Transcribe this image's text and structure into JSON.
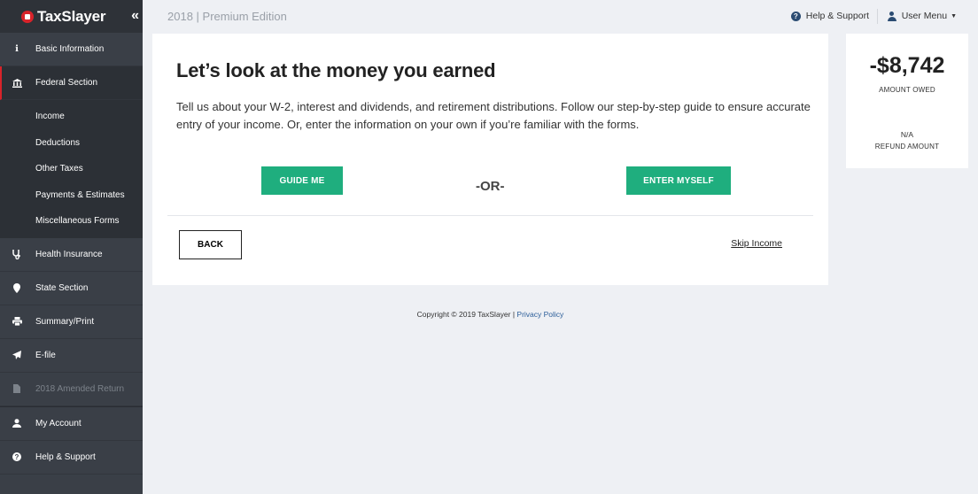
{
  "brand": {
    "name": "TaxSlayer",
    "collapse_icon": "double-chevron-left-icon"
  },
  "topbar": {
    "edition": "2018 | Premium Edition",
    "help_label": "Help & Support",
    "user_menu_label": "User Menu"
  },
  "sidebar": {
    "items": [
      {
        "label": "Basic Information",
        "icon": "info-icon"
      },
      {
        "label": "Federal Section",
        "icon": "bank-icon"
      },
      {
        "label": "Health Insurance",
        "icon": "stethoscope-icon"
      },
      {
        "label": "State Section",
        "icon": "map-pin-icon"
      },
      {
        "label": "Summary/Print",
        "icon": "printer-icon"
      },
      {
        "label": "E-file",
        "icon": "send-icon"
      },
      {
        "label": "2018 Amended Return",
        "icon": "document-icon"
      },
      {
        "label": "My Account",
        "icon": "user-icon"
      },
      {
        "label": "Help & Support",
        "icon": "question-icon"
      }
    ],
    "federal_sub": [
      "Income",
      "Deductions",
      "Other Taxes",
      "Payments & Estimates",
      "Miscellaneous Forms"
    ]
  },
  "main": {
    "heading": "Let’s look at the money you earned",
    "description": "Tell us about your W-2, interest and dividends, and retirement distributions. Follow our step-by-step guide to ensure accurate entry of your income. Or, enter the information on your own if you’re familiar with the forms.",
    "guide_button": "GUIDE ME",
    "or_text": "-OR-",
    "enter_button": "ENTER MYSELF",
    "back_button": "BACK",
    "skip_link": "Skip Income"
  },
  "summary": {
    "amount_owed_value": "-$8,742",
    "amount_owed_label": "AMOUNT OWED",
    "refund_value": "N/A",
    "refund_label": "REFUND AMOUNT"
  },
  "footer": {
    "copyright": "Copyright © 2019 TaxSlayer | ",
    "privacy": "Privacy Policy"
  },
  "colors": {
    "accent": "#1fae7e",
    "brand_red": "#d8232a",
    "sidebar": "#3a3f47"
  }
}
